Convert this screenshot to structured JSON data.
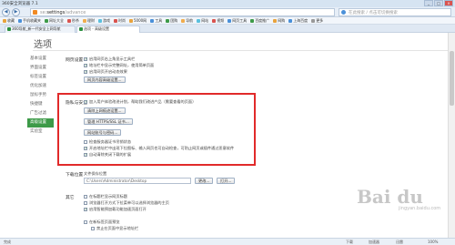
{
  "window": {
    "title": "360安全浏览器 7.1"
  },
  "nav": {
    "back": "◀",
    "forward": "▶",
    "address_prefix": "se:",
    "address_main": "settings",
    "address_suffix": "/advance",
    "search_placeholder": "在此搜索 / 点击可切换搜索"
  },
  "bookmarks": [
    {
      "label": "收藏",
      "color": "#e8a33d"
    },
    {
      "label": "手机收藏夹",
      "color": "#4a90d9"
    },
    {
      "label": "网址大全",
      "color": "#3d9a48"
    },
    {
      "label": "秒杀",
      "color": "#d9534f"
    },
    {
      "label": "理财",
      "color": "#f0ad4e"
    },
    {
      "label": "游戏",
      "color": "#5bc0de"
    },
    {
      "label": "时尚",
      "color": "#d9534f"
    },
    {
      "label": "5000网",
      "color": "#e8a33d"
    },
    {
      "label": "工具",
      "color": "#4a90d9"
    },
    {
      "label": "团购",
      "color": "#3d9a48"
    },
    {
      "label": "导航",
      "color": "#f0ad4e"
    },
    {
      "label": "网站",
      "color": "#5bc0de"
    },
    {
      "label": "视频",
      "color": "#d9534f"
    },
    {
      "label": "网页工具",
      "color": "#4a90d9"
    },
    {
      "label": "百度推广",
      "color": "#3d9a48"
    },
    {
      "label": "网购",
      "color": "#e8a33d"
    },
    {
      "label": "上海百度",
      "color": "#4a90d9"
    },
    {
      "label": "更多",
      "color": "#999999"
    }
  ],
  "tabs": [
    {
      "label": "360导航_新一代安全上网导航"
    },
    {
      "label": "选项 - 高级设置"
    }
  ],
  "page": {
    "title": "选项"
  },
  "sidebar": {
    "items": [
      "基本设置",
      "界面设置",
      "标签设置",
      "优化加速",
      "鼠标手势",
      "快捷键",
      "广告过滤",
      "高级设置",
      "实验室"
    ]
  },
  "sections": {
    "web": {
      "label": "网页设置",
      "options": [
        "启用网页右上角显示工具栏",
        "地址栏中显示完整网址，使用简单页面",
        "启用网页开启动态效果"
      ],
      "button": "网页内容高级设置..."
    },
    "privacy": {
      "label": "隐私与安全",
      "option1": "加入用户体验改进计划，帮助我们改进产品（需要查看的页面）",
      "btn_clear": "清除上网痕迹设置...",
      "btn_cert": "管理 HTTPS/SSL 证书...",
      "btn_pass": "网站账号与密码...",
      "options": [
        "检查服务器证书吊销状态",
        "开启地址栏中出现下拉图标、输入网页也可自动检查，可防止网页或插件通过恶意软件",
        "自动清除关闭下载的扩展"
      ]
    },
    "download": {
      "label": "下载位置",
      "path_label": "文件保存位置",
      "path_value": "C:\\Users\\Administrator\\Desktop",
      "btn_change": "更改...",
      "btn_open": "打开..."
    },
    "other": {
      "label": "其它",
      "options": [
        "在标题栏显示网页标题",
        "浏览器打开方式下拉菜单可以选择浏览器的主页",
        "启用智能预加载功能加速页面打开"
      ],
      "more": [
        "在新标签页面预览",
        "禁止在页面中显示地址栏"
      ]
    }
  },
  "status": {
    "left": "完成",
    "right": "100%",
    "extras": [
      "下载",
      "加速器",
      "迅雷"
    ]
  },
  "watermark": {
    "main": "Bai du",
    "sub": "jingyan.baidu.com"
  }
}
